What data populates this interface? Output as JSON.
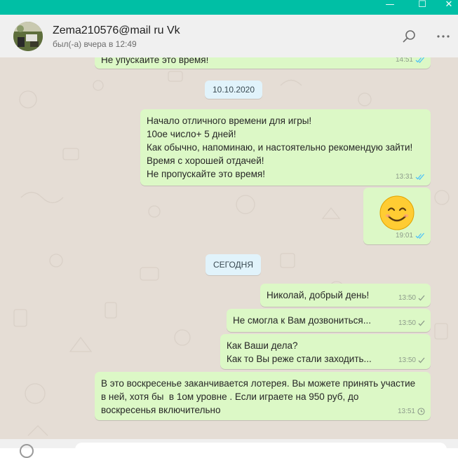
{
  "window": {
    "minimize_glyph": "—",
    "maximize_glyph": "☐",
    "close_glyph": "✕",
    "accent_color": "#00bfa5"
  },
  "header": {
    "name": "Zema210576@mail ru Vk",
    "status": "был(-а) вчера в 12:49",
    "icons": [
      "search-icon",
      "more-options-icon"
    ]
  },
  "colors": {
    "chat_background": "#e5ddd5",
    "outgoing_bubble": "#dcf8c6",
    "date_chip": "#e1f3fb",
    "read_tick": "#4fc3f7",
    "sent_tick": "#8c9a8a"
  },
  "messages": [
    {
      "text": "Не упускайте это время!",
      "time": "14:51",
      "status": "read"
    },
    {
      "date": "10.10.2020"
    },
    {
      "text": "Начало отличного времени для игры!\n10ое число+ 5 дней!\nКак обычно, напоминаю, и настоятельно рекомендую зайти!\nВремя с хорошей отдачей!\nНе пропускайте это время!",
      "time": "13:31",
      "status": "read"
    },
    {
      "emoji": "😊",
      "time": "19:01",
      "status": "read"
    },
    {
      "date": "СЕГОДНЯ"
    },
    {
      "text": "Николай, добрый день!",
      "time": "13:50",
      "status": "sent"
    },
    {
      "text": "Не смогла к Вам дозвониться...",
      "time": "13:50",
      "status": "sent"
    },
    {
      "text": "Как Ваши дела?\nКак то Вы реже стали заходить...",
      "time": "13:50",
      "status": "sent"
    },
    {
      "text": "В это воскресенье заканчивается лотерея. Вы можете принять участие\nв ней, хотя бы  в 1ом уровне . Если играете на 950 руб, до\nвоскресенья включительно",
      "time": "13:51",
      "status": "pending"
    }
  ]
}
